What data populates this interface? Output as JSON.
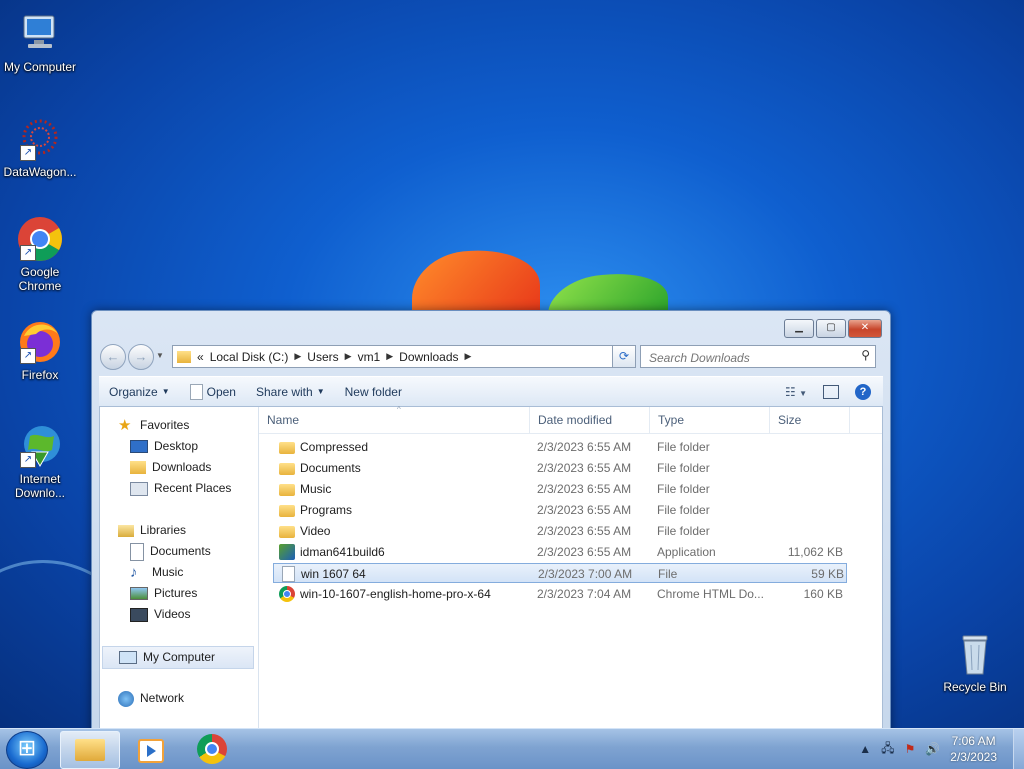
{
  "desktop": {
    "icons": [
      {
        "label": "My Computer"
      },
      {
        "label": "DataWagon..."
      },
      {
        "label": "Google Chrome"
      },
      {
        "label": "Firefox"
      },
      {
        "label": "Internet Downlo..."
      },
      {
        "label": "Recycle Bin"
      }
    ]
  },
  "explorer": {
    "address": {
      "overflow": "«",
      "segments": [
        "Local Disk (C:)",
        "Users",
        "vm1",
        "Downloads"
      ]
    },
    "search": {
      "placeholder": "Search Downloads"
    },
    "toolbar": {
      "organize": "Organize",
      "open": "Open",
      "share_with": "Share with",
      "new_folder": "New folder"
    },
    "nav": {
      "favorites": "Favorites",
      "desktop": "Desktop",
      "downloads": "Downloads",
      "recent_places": "Recent Places",
      "libraries": "Libraries",
      "documents": "Documents",
      "music": "Music",
      "pictures": "Pictures",
      "videos": "Videos",
      "my_computer": "My Computer",
      "network": "Network"
    },
    "columns": {
      "name": "Name",
      "date": "Date modified",
      "type": "Type",
      "size": "Size"
    },
    "files": [
      {
        "name": "Compressed",
        "date": "2/3/2023 6:55 AM",
        "type": "File folder",
        "size": "",
        "icon": "folder-icon"
      },
      {
        "name": "Documents",
        "date": "2/3/2023 6:55 AM",
        "type": "File folder",
        "size": "",
        "icon": "folder-icon"
      },
      {
        "name": "Music",
        "date": "2/3/2023 6:55 AM",
        "type": "File folder",
        "size": "",
        "icon": "folder-icon"
      },
      {
        "name": "Programs",
        "date": "2/3/2023 6:55 AM",
        "type": "File folder",
        "size": "",
        "icon": "folder-icon"
      },
      {
        "name": "Video",
        "date": "2/3/2023 6:55 AM",
        "type": "File folder",
        "size": "",
        "icon": "folder-icon"
      },
      {
        "name": "idman641build6",
        "date": "2/3/2023 6:55 AM",
        "type": "Application",
        "size": "11,062 KB",
        "icon": "application-icon"
      },
      {
        "name": "win 1607 64",
        "date": "2/3/2023 7:00 AM",
        "type": "File",
        "size": "59 KB",
        "icon": "file-icon",
        "selected": true
      },
      {
        "name": "win-10-1607-english-home-pro-x-64",
        "date": "2/3/2023 7:04 AM",
        "type": "Chrome HTML Do...",
        "size": "160 KB",
        "icon": "chrome-icon"
      }
    ]
  },
  "taskbar": {
    "time": "7:06 AM",
    "date": "2/3/2023"
  }
}
